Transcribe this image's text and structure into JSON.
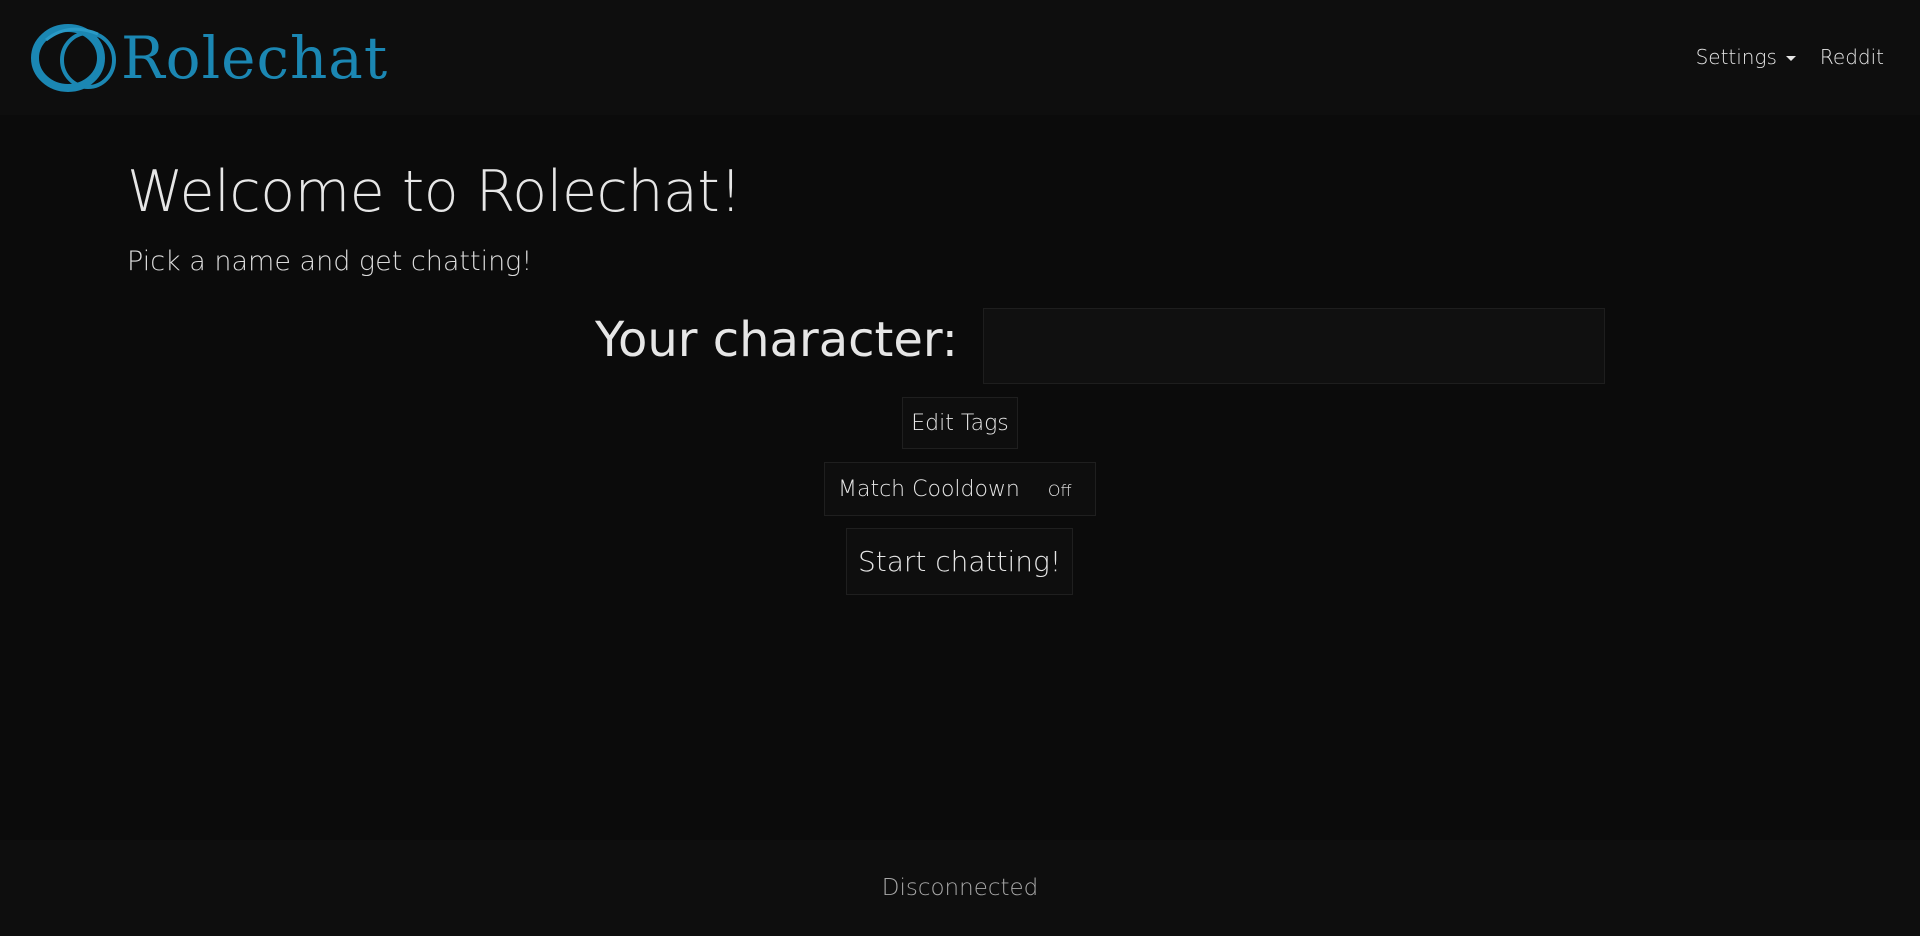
{
  "navbar": {
    "brand": "Rolechat",
    "settings_label": "Settings",
    "reddit_label": "Reddit"
  },
  "hero": {
    "title": "Welcome to Rolechat!",
    "subtitle": "Pick a name and get chatting!"
  },
  "character": {
    "label": "Your character:",
    "value": "",
    "placeholder": ""
  },
  "buttons": {
    "edit_tags": "Edit Tags",
    "match_cooldown": "Match Cooldown",
    "match_cooldown_state": "Off",
    "start_chatting": "Start chatting!"
  },
  "footer": {
    "status": "Disconnected"
  },
  "colors": {
    "background": "#0b0b0b",
    "navbar": "#0e0e0e",
    "brand": "#1b87b3",
    "text": "#e6e6e6",
    "status_text": "#a8a8a8"
  },
  "icons": {
    "logo": "rolechat-rings-logo",
    "settings_dropdown": "caret-down-icon"
  }
}
